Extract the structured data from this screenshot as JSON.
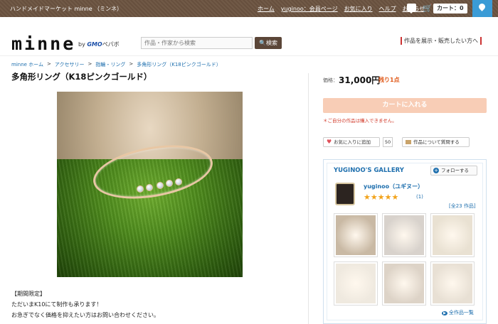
{
  "topbar": {
    "site_name": "ハンドメイドマーケット minne （ミンネ）",
    "nav": [
      "ホーム",
      "yuginoo：会員ページ",
      "お気に入り",
      "ヘルプ",
      "お知らせ"
    ],
    "cart_label": "カート：0"
  },
  "header": {
    "logo": "minne",
    "gmo_prefix": "by",
    "gmo_brand": "GMO",
    "gmo_suffix": "ペパボ",
    "search_placeholder": "作品・作家から検索",
    "search_button": "検索",
    "sell_link": "作品を展示・販売したい方へ"
  },
  "breadcrumb": [
    "minne ホーム",
    "アクセサリー",
    "指輪・リング",
    "多角形リング（K18ピンクゴールド）"
  ],
  "product": {
    "title": "多角形リング（K18ピンクゴールド）",
    "description": [
      "【期間限定】",
      "ただいまK10にて制作も承ります！",
      "お急ぎでなく価格を抑えたい方はお問い合わせください。"
    ]
  },
  "purchase": {
    "price_label": "価格：",
    "price": "31,000円",
    "stock": "残り1点",
    "cart_button": "カートに入れる",
    "warning": "＊ご自分の作品は購入できません。",
    "favorite_button": "お気に入りに追加",
    "favorite_count": "50",
    "ask_button": "作品について質問する"
  },
  "gallery": {
    "title": "YUGINOO'S GALLERY",
    "follow_button": "フォローする",
    "user_name": "yuginoo（ユギヌー）",
    "stars": "★★★★★",
    "rating_count": "(1)",
    "total_works": "[全23 作品]",
    "all_works_link": "全作品一覧",
    "thumb_colors": [
      "#c9b9a4",
      "#d8d2cc",
      "#e9e1d2",
      "#efe9df",
      "#ddd3c7",
      "#e8e0d4"
    ]
  }
}
